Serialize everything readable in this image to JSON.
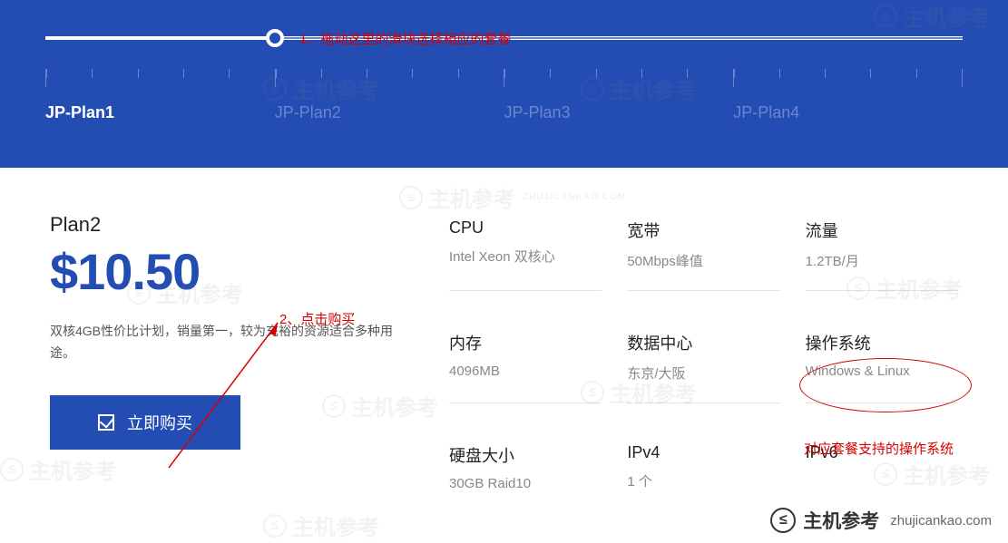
{
  "slider": {
    "plans": [
      "JP-Plan1",
      "JP-Plan2",
      "JP-Plan3",
      "JP-Plan4"
    ],
    "active_index": 0
  },
  "annotations": {
    "a1": "1、拖动这里的滑块选择相应的套餐",
    "a2": "2、点击购买",
    "a3": "对应套餐支持的操作系统"
  },
  "plan": {
    "name": "Plan2",
    "price": "$10.50",
    "desc": "双核4GB性价比计划，销量第一，较为充裕的资源适合多种用途。",
    "buy_label": "立即购买"
  },
  "specs": {
    "cpu": {
      "label": "CPU",
      "value": "Intel Xeon 双核心"
    },
    "bandwidth": {
      "label": "宽带",
      "value": "50Mbps峰值"
    },
    "traffic": {
      "label": "流量",
      "value": "1.2TB/月"
    },
    "ram": {
      "label": "内存",
      "value": "4096MB"
    },
    "dc": {
      "label": "数据中心",
      "value": "东京/大阪"
    },
    "os": {
      "label": "操作系统",
      "value": "Windows & Linux"
    },
    "disk": {
      "label": "硬盘大小",
      "value": "30GB Raid10"
    },
    "ipv4": {
      "label": "IPv4",
      "value": "1 个"
    },
    "ipv6": {
      "label": "IPv6",
      "value": ""
    }
  },
  "watermark": {
    "text": "主机参考",
    "sub": "ZHUJICANKAO.COM"
  },
  "footer": {
    "text": "主机参考",
    "url": "zhujicankao.com"
  }
}
